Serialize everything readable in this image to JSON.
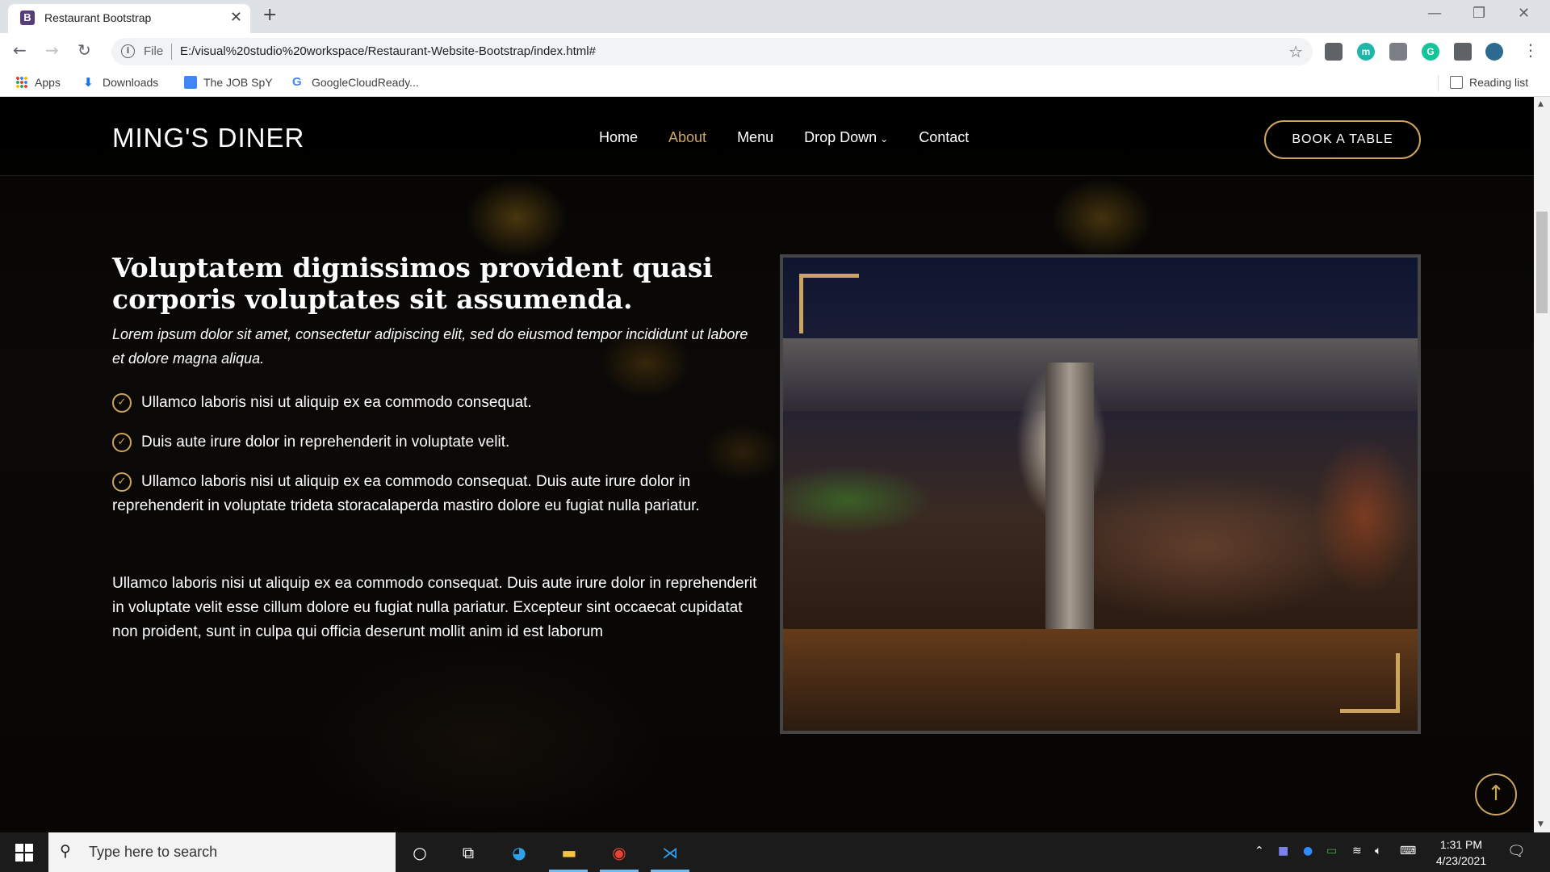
{
  "browser": {
    "tab_title": "Restaurant Bootstrap",
    "tab_favicon": "B",
    "file_label": "File",
    "url": "E:/visual%20studio%20workspace/Restaurant-Website-Bootstrap/index.html#",
    "bookmarks": [
      {
        "label": "Apps",
        "icon": "apps-grid-icon"
      },
      {
        "label": "Downloads",
        "icon": "download-icon"
      },
      {
        "label": "The JOB SpY",
        "icon": "doc-icon"
      },
      {
        "label": "GoogleCloudReady...",
        "icon": "google-icon"
      }
    ],
    "reading_list": "Reading list"
  },
  "site": {
    "logo": "MING'S DINER",
    "nav": [
      "Home",
      "About",
      "Menu",
      "Drop Down",
      "Contact"
    ],
    "active_nav": "About",
    "book_button": "BOOK A TABLE",
    "accent_color": "#cda45e"
  },
  "about": {
    "title": "Voluptatem dignissimos provident quasi corporis voluptates sit assumenda.",
    "lead": "Lorem ipsum dolor sit amet, consectetur adipiscing elit, sed do eiusmod tempor incididunt ut labore et dolore magna aliqua.",
    "checks": [
      "Ullamco laboris nisi ut aliquip ex ea commodo consequat.",
      "Duis aute irure dolor in reprehenderit in voluptate velit.",
      "Ullamco laboris nisi ut aliquip ex ea commodo consequat. Duis aute irure dolor in reprehenderit in voluptate trideta storacalaperda mastiro dolore eu fugiat nulla pariatur."
    ],
    "paragraph": "Ullamco laboris nisi ut aliquip ex ea commodo consequat. Duis aute irure dolor in reprehenderit in voluptate velit esse cillum dolore eu fugiat nulla pariatur. Excepteur sint occaecat cupidatat non proident, sunt in culpa qui officia deserunt mollit anim id est laborum"
  },
  "taskbar": {
    "search_placeholder": "Type here to search",
    "time": "1:31 PM",
    "date": "4/23/2021"
  }
}
